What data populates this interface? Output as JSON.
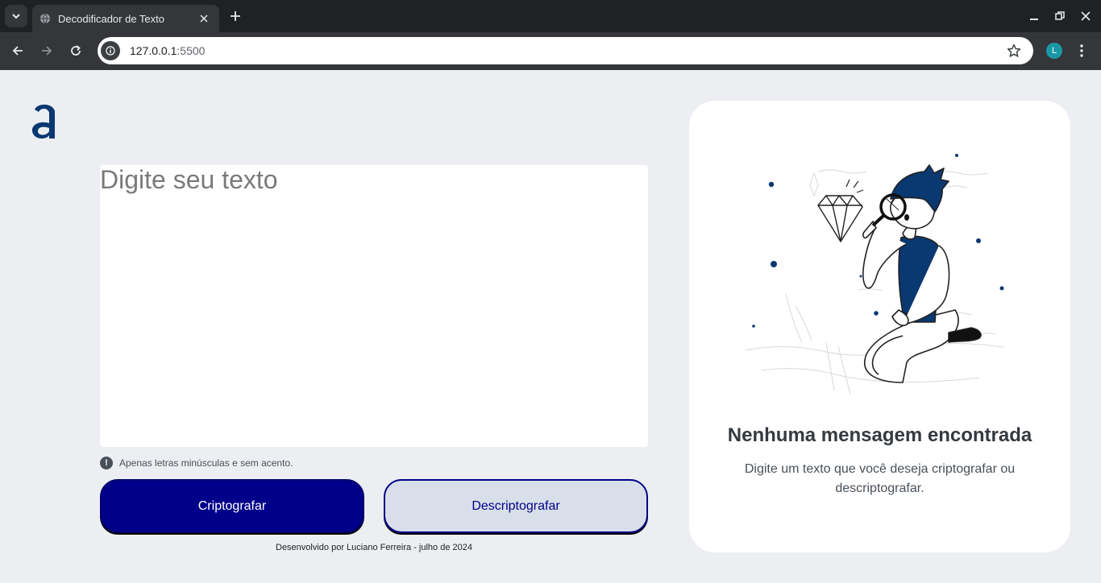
{
  "browser": {
    "tab_title": "Decodificador de Texto",
    "url_host": "127.0.0.1",
    "url_port": ":5500",
    "profile_initial": "L"
  },
  "app": {
    "logo_icon": "alura-a-logo",
    "input_placeholder": "Digite seu texto",
    "input_value": "",
    "hint_icon": "!",
    "hint_text": "Apenas letras minúsculas e sem acento.",
    "encrypt_label": "Criptografar",
    "decrypt_label": "Descriptografar",
    "footer_text": "Desenvolvido por Luciano Ferreira - julho de 2024"
  },
  "output": {
    "illustration": "person-with-magnifier-examining-diamond",
    "title": "Nenhuma mensagem encontrada",
    "description": "Digite um texto que você deseja criptografar ou descriptografar."
  },
  "colors": {
    "accent": "#0a3871",
    "primary_button": "#00008b",
    "secondary_button_bg": "#d8dfe8",
    "page_bg": "#eceef2"
  }
}
